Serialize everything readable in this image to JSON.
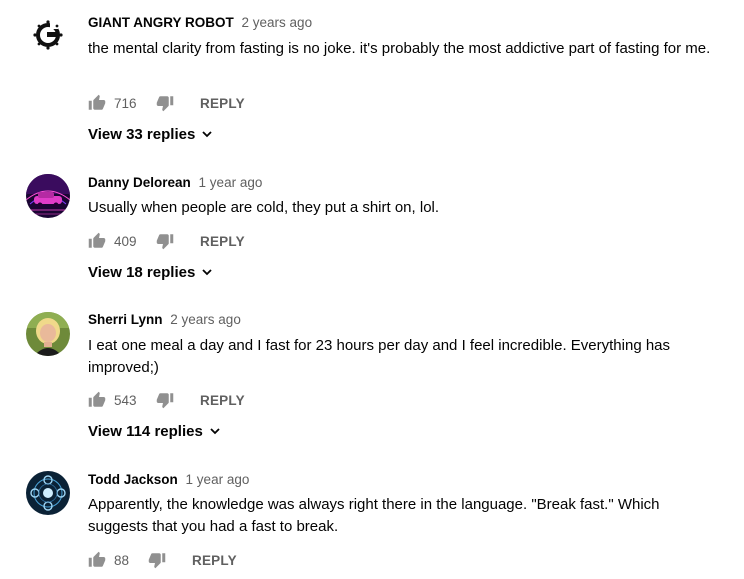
{
  "comments": [
    {
      "author": "GIANT ANGRY ROBOT",
      "time": "2 years ago",
      "text": "the mental clarity from fasting is no joke. it's probably the most addictive part of fasting for me.",
      "likes": "716",
      "reply_label": "REPLY",
      "view_replies": "View 33 replies",
      "avatar": "giant-angry-robot-logo"
    },
    {
      "author": "Danny Delorean",
      "time": "1 year ago",
      "text": "Usually when people are cold, they put a shirt on, lol.",
      "likes": "409",
      "reply_label": "REPLY",
      "view_replies": "View 18 replies",
      "avatar": "synthwave-car"
    },
    {
      "author": "Sherri Lynn",
      "time": "2 years ago",
      "text": "I eat one meal a day and I fast for 23 hours per day and I feel incredible. Everything has improved;)",
      "likes": "543",
      "reply_label": "REPLY",
      "view_replies": "View 114 replies",
      "avatar": "portrait-photo"
    },
    {
      "author": "Todd Jackson",
      "time": "1 year ago",
      "text": "Apparently, the knowledge was always right there in the language. \"Break fast.\" Which suggests that you had a fast to break.",
      "likes": "88",
      "reply_label": "REPLY",
      "avatar": "glowing-orbs"
    }
  ],
  "colors": {
    "text_primary": "#030303",
    "text_secondary": "#606060",
    "background": "#ffffff"
  }
}
